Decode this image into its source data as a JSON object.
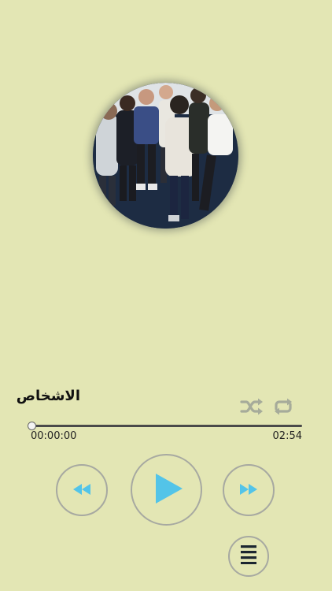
{
  "player": {
    "track_title": "الاشخاص",
    "elapsed": "00:00:00",
    "duration": "02:54",
    "progress_fraction": 0.0
  },
  "controls": {
    "shuffle_icon": "shuffle-icon",
    "repeat_icon": "repeat-icon",
    "rewind_icon": "rewind-icon",
    "play_icon": "play-icon",
    "forward_icon": "fast-forward-icon",
    "playlist_icon": "playlist-icon"
  },
  "colors": {
    "background": "#e3e6b4",
    "accent": "#53c4e8",
    "inactive_icon": "#a6ab9a",
    "button_ring": "#a7a9a1"
  }
}
